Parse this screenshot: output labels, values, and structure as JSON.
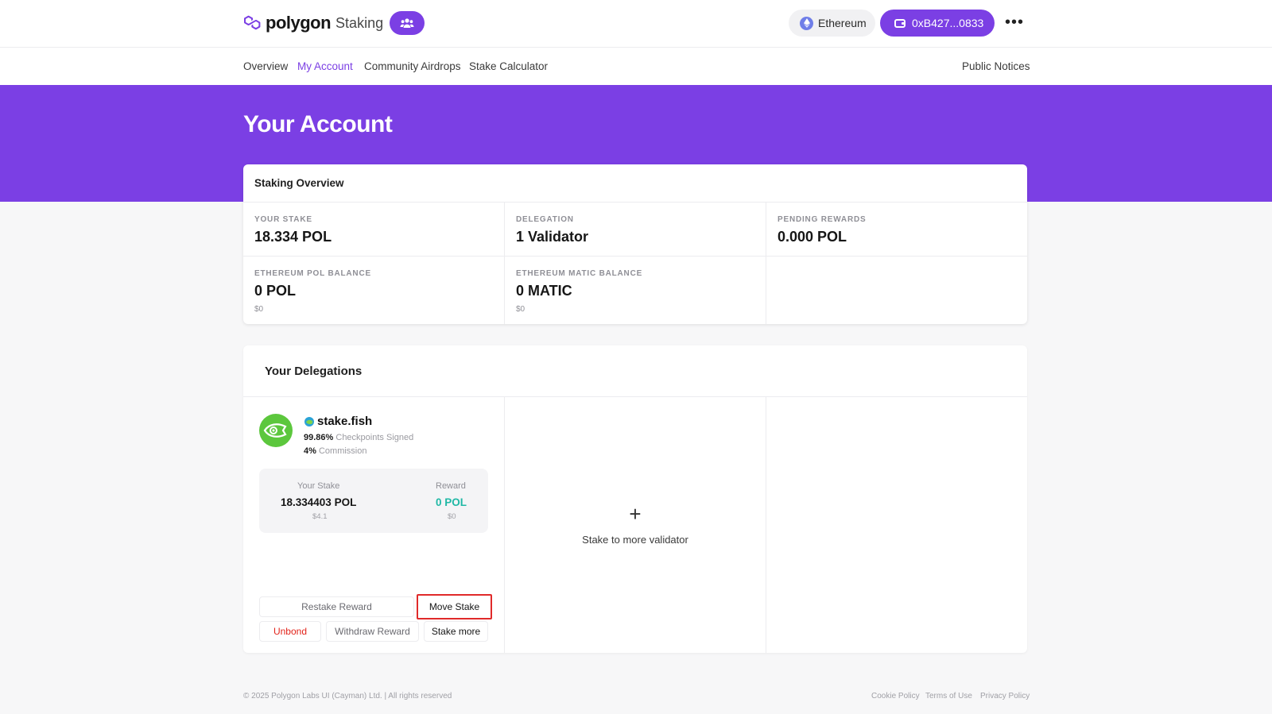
{
  "header": {
    "brand": "polygon",
    "product": "Staking",
    "network_label": "Ethereum",
    "wallet_label": "0xB427...0833",
    "more_label": "•••"
  },
  "nav": {
    "items": [
      {
        "label": "Overview"
      },
      {
        "label": "My Account"
      },
      {
        "label": "Community Airdrops"
      },
      {
        "label": "Stake Calculator"
      }
    ],
    "right": "Public Notices",
    "active": "My Account"
  },
  "hero": {
    "title": "Your Account"
  },
  "overview": {
    "title": "Staking Overview",
    "stats": [
      {
        "label": "YOUR STAKE",
        "value": "18.334 POL"
      },
      {
        "label": "DELEGATION",
        "value": "1 Validator"
      },
      {
        "label": "PENDING REWARDS",
        "value": "0.000 POL"
      },
      {
        "label": "ETHEREUM POL BALANCE",
        "value": "0 POL",
        "sub": "$0"
      },
      {
        "label": "ETHEREUM MATIC BALANCE",
        "value": "0 MATIC",
        "sub": "$0"
      }
    ]
  },
  "delegations": {
    "title": "Your Delegations",
    "validator": {
      "name": "stake.fish",
      "checkpoints_value": "99.86%",
      "checkpoints_label": "Checkpoints Signed",
      "commission_value": "4%",
      "commission_label": "Commission",
      "stake_label": "Your Stake",
      "stake_value": "18.334403 POL",
      "stake_usd": "$4.1",
      "reward_label": "Reward",
      "reward_value": "0 POL",
      "reward_usd": "$0"
    },
    "actions": {
      "restake": "Restake Reward",
      "move": "Move Stake",
      "unbond": "Unbond",
      "withdraw": "Withdraw Reward",
      "stake_more": "Stake more"
    },
    "add": {
      "icon": "+",
      "label": "Stake to more validator"
    }
  },
  "footer": {
    "copyright": "© 2025 Polygon Labs UI (Cayman) Ltd. | All rights reserved",
    "links": [
      "Cookie Policy",
      "Terms of Use",
      "Privacy Policy"
    ]
  },
  "colors": {
    "brand": "#7b3fe4",
    "reward": "#1fb8a5",
    "danger": "#e2231a",
    "highlight": "#e02a2a"
  }
}
